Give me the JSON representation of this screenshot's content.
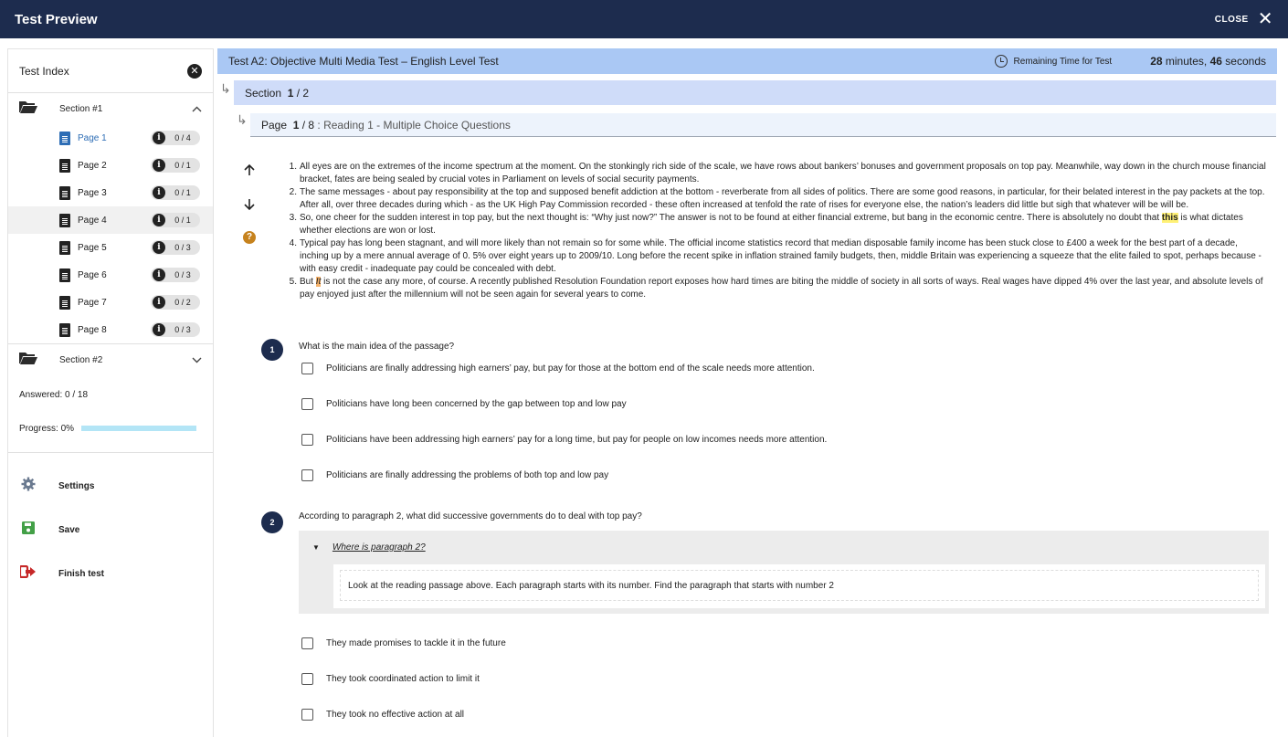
{
  "header": {
    "title": "Test Preview",
    "close_label": "CLOSE"
  },
  "sidebar": {
    "title": "Test Index",
    "sections": [
      {
        "label": "Section #1",
        "pages": [
          {
            "label": "Page 1",
            "count": "0 / 4"
          },
          {
            "label": "Page 2",
            "count": "0 / 1"
          },
          {
            "label": "Page 3",
            "count": "0 / 1"
          },
          {
            "label": "Page 4",
            "count": "0 / 1"
          },
          {
            "label": "Page 5",
            "count": "0 / 3"
          },
          {
            "label": "Page 6",
            "count": "0 / 3"
          },
          {
            "label": "Page 7",
            "count": "0 / 2"
          },
          {
            "label": "Page 8",
            "count": "0 / 3"
          }
        ]
      },
      {
        "label": "Section #2"
      }
    ],
    "answered": "Answered: 0 / 18",
    "progress_label": "Progress: 0%",
    "progress_value": 0,
    "actions": {
      "settings": "Settings",
      "save": "Save",
      "finish": "Finish test"
    }
  },
  "test": {
    "title": "Test A2: Objective Multi Media Test – English Level Test",
    "remaining_label": "Remaining Time for Test",
    "minutes": "28",
    "minutes_unit": "minutes,",
    "seconds": "46",
    "seconds_unit": "seconds"
  },
  "section_bar": {
    "label": "Section",
    "current": "1",
    "total": "/ 2"
  },
  "page_bar": {
    "label": "Page",
    "current": "1",
    "total": "/ 8",
    "subtitle": ": Reading 1 - Multiple Choice Questions"
  },
  "passage": {
    "p1": "All eyes are on the extremes of the income spectrum at the moment. On the stonkingly rich side of the scale, we have rows about bankers’ bonuses and government proposals on top pay. Meanwhile, way down in the church mouse financial bracket, fates are being sealed by crucial votes in Parliament on levels of social security payments.",
    "p2": "The same messages - about pay responsibility at the top and supposed benefit addiction at the bottom - reverberate from all sides of politics. There are some good reasons, in particular, for their belated interest in the pay packets at the top. After all, over three decades during which - as the UK High Pay Commission recorded - these often increased at tenfold the rate of rises for everyone else, the nation’s leaders did little but sigh that whatever will be will be.",
    "p3_a": "So, one cheer for the sudden interest in top pay, but the next thought is: “Why just now?” The answer is not to be found at either financial extreme, but bang in the economic centre. There is absolutely no doubt that ",
    "p3_hl": "this",
    "p3_b": " is what dictates whether elections are won or lost.",
    "p4": "Typical pay has long been stagnant, and will more likely than not remain so for some while. The official income statistics record that median disposable family income has been stuck close to £400 a week for the best part of a decade, inching up by a mere annual average of 0. 5% over eight years up to 2009/10. Long before the recent spike in inflation strained family budgets, then, middle Britain was experiencing a squeeze that the elite failed to spot, perhaps because - with easy credit - inadequate pay could be concealed with debt.",
    "p5_a": "But ",
    "p5_hl": "It",
    "p5_b": " is not the case any more, of course. A recently published Resolution Foundation report exposes how hard times are biting the middle of society in all sorts of ways. Real wages have dipped 4% over the last year, and absolute levels of pay enjoyed just after the millennium will not be seen again for several years to come."
  },
  "questions": [
    {
      "number": "1",
      "stem": "What is the main idea of the passage?",
      "options": [
        "Politicians are finally addressing high earners’ pay, but pay for those at the bottom end of the scale needs more attention.",
        "Politicians have long been concerned by the gap between top and low pay",
        "Politicians have been addressing high earners’ pay for a long time, but pay for people on low incomes needs more attention.",
        "Politicians are finally addressing the problems of both top and low pay"
      ]
    },
    {
      "number": "2",
      "stem": "According to paragraph 2, what did successive governments do to deal with top pay?",
      "hint_title": "Where is paragraph 2?",
      "hint_text": "Look at the reading passage above. Each paragraph starts with its number. Find the paragraph that starts with number 2",
      "options": [
        "They made promises to tackle it in the future",
        "They took coordinated action to limit it",
        "They took no effective action at all"
      ]
    }
  ],
  "colors": {
    "topbar": "#1d2c4e",
    "test_bar": "#aac8f4",
    "section_bar": "#cfdcf9",
    "page_bar": "#edf3fc",
    "active_page": "#2d6db5",
    "save_icon": "#43a047",
    "finish_icon": "#c62828",
    "help_icon": "#c6821d"
  }
}
